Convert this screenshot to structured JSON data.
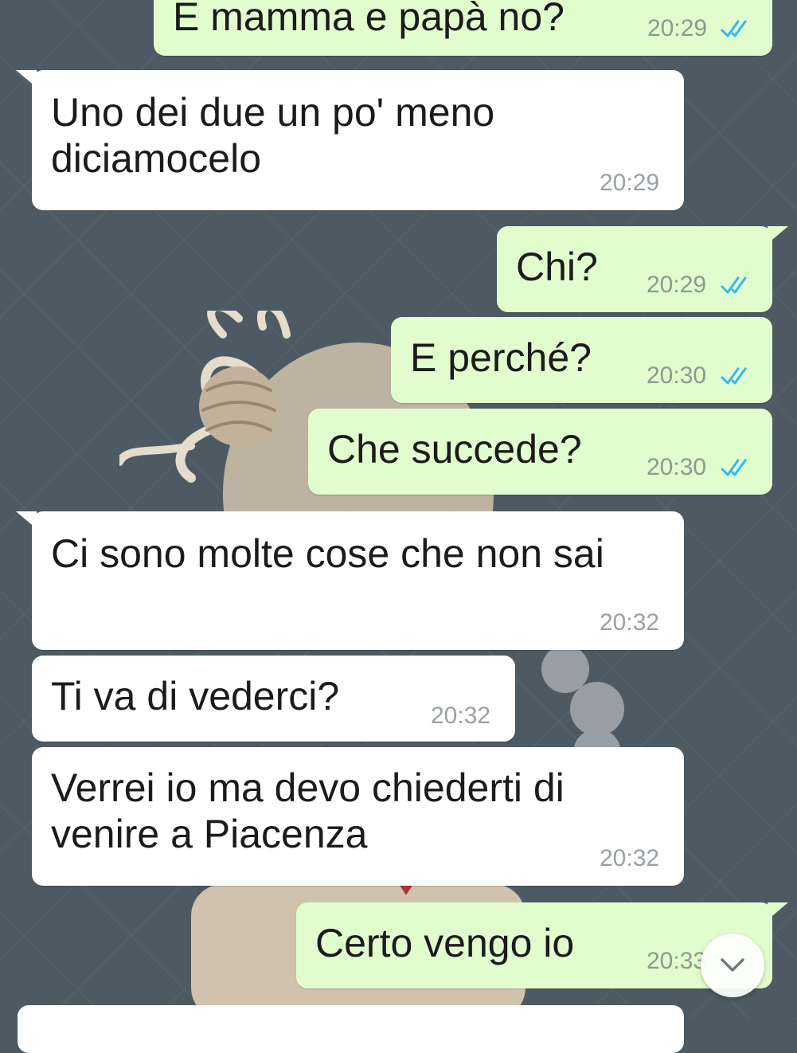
{
  "messages": [
    {
      "direction": "outgoing",
      "text": "E mamma e papà no?",
      "time": "20:29",
      "status": "read"
    },
    {
      "direction": "incoming",
      "text": "Uno dei due un po' meno\ndiciamocelo",
      "time": "20:29"
    },
    {
      "direction": "outgoing",
      "text": "Chi?",
      "time": "20:29",
      "status": "read"
    },
    {
      "direction": "outgoing",
      "text": "E perché?",
      "time": "20:30",
      "status": "read"
    },
    {
      "direction": "outgoing",
      "text": "Che succede?",
      "time": "20:30",
      "status": "read"
    },
    {
      "direction": "incoming",
      "text": "Ci sono molte cose che non sai",
      "time": "20:32"
    },
    {
      "direction": "incoming",
      "text": "Ti va di vederci?",
      "time": "20:32"
    },
    {
      "direction": "incoming",
      "text": "Verrei io ma devo chiederti di\nvenire a Piacenza",
      "time": "20:32"
    },
    {
      "direction": "outgoing",
      "text": "Certo vengo io",
      "time": "20:33",
      "status": "read"
    }
  ],
  "colors": {
    "wallpaper": "#4d5a63",
    "incoming_bubble": "#ffffff",
    "outgoing_bubble": "#e2fdcd",
    "read_ticks": "#34b7f1"
  },
  "icons": {
    "read_status": "double-check-icon",
    "scroll": "chevron-down-icon"
  }
}
